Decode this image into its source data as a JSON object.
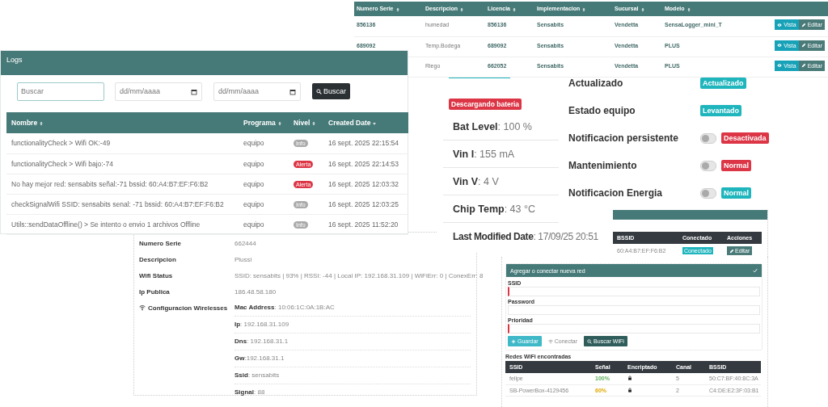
{
  "devices_table": {
    "columns": [
      {
        "label": "Numero Serie",
        "kind": "sortable"
      },
      {
        "label": "Descripcion",
        "kind": "sortable"
      },
      {
        "label": "Licencia",
        "kind": "sortable"
      },
      {
        "label": "Implementacion",
        "kind": "sortable"
      },
      {
        "label": "Sucursal",
        "kind": "sortable"
      },
      {
        "label": "Modelo",
        "kind": "sortable"
      }
    ],
    "rows": [
      {
        "numero_serie": "856136",
        "descripcion": "humedad",
        "licencia": "856136",
        "implementacion": "Sensabits",
        "sucursal": "Vendetta",
        "modelo": "SensaLogger_mini_T",
        "actions": [
          "Vista",
          "Editar"
        ]
      },
      {
        "numero_serie": "689092",
        "descripcion": "Temp.Bodega",
        "licencia": "689092",
        "implementacion": "Sensabits",
        "sucursal": "Vendetta",
        "modelo": "PLUS",
        "actions": [
          "Vista",
          "Editar"
        ]
      },
      {
        "descripcion": "Riego",
        "licencia": "662052",
        "implementacion": "Sensabits",
        "sucursal": "Vendetta",
        "modelo": "PLUS",
        "actions": [
          "Vista",
          "Editar"
        ]
      }
    ]
  },
  "logs": {
    "title": "Logs",
    "search": {
      "placeholder": "Buscar"
    },
    "date_from": {
      "placeholder": "dd/mm/aaaa"
    },
    "date_to": {
      "placeholder": "dd/mm/aaaa"
    },
    "search_button": "Buscar",
    "table": {
      "columns": [
        {
          "label": "Nombre",
          "kind": "sortable"
        },
        {
          "label": "Programa",
          "kind": "sortable"
        },
        {
          "label": "Nivel",
          "kind": "sortable"
        },
        {
          "label": "Created Date",
          "kind": "sorted"
        }
      ],
      "rows": [
        {
          "nombre": "functionalityCheck > Wifi OK:-49",
          "programa": "equipo",
          "nivel": {
            "label": "Info",
            "kind": "info"
          },
          "created": "16 sept. 2025 22:15:54"
        },
        {
          "nombre": "functionalityCheck > Wifi bajo:-74",
          "programa": "equipo",
          "nivel": {
            "label": "Alerta",
            "kind": "alert"
          },
          "created": "16 sept. 2025 22:14:53"
        },
        {
          "nombre": "No hay mejor red: sensabits señal:-71 bssid: 60:A4:B7:EF:F6:B2",
          "programa": "equipo",
          "nivel": {
            "label": "Alerta",
            "kind": "alert"
          },
          "created": "16 sept. 2025 12:03:32"
        },
        {
          "nombre": "checkSignalWifi SSID: sensabits senal: -71 bssid: 60:A4:B7:EF:F6:B2",
          "programa": "equipo",
          "nivel": {
            "label": "Info",
            "kind": "info"
          },
          "created": "16 sept. 2025 12:03:25"
        },
        {
          "nombre": "Utils::sendDataOffline() > Se intento o envio 1 archivos Offline",
          "programa": "equipo",
          "nivel": {
            "label": "Info",
            "kind": "info"
          },
          "created": "16 sept. 2025 11:52:20"
        }
      ]
    }
  },
  "status": {
    "battery_badge": "Descargando bateria",
    "readings": [
      "**Bat Level**: 100 %",
      "**Vin I**: 155 mA",
      "**Vin V**: 4 V",
      "**Chip Temp**: 43 °C",
      "**Last Modified Date**: 17/09/25 20:51"
    ],
    "flags": [
      {
        "label": "Actualizado",
        "kind": "badge",
        "badge": "Actualizado",
        "color": "#1fb5bd"
      },
      {
        "label": "Estado equipo",
        "kind": "badge",
        "badge": "Levantado",
        "color": "#1fb5bd"
      },
      {
        "label": "Notificacion persistente",
        "kind": "switch",
        "on": false,
        "badge": "Desactivada",
        "color": "#dc3545"
      },
      {
        "label": "Mantenimiento",
        "kind": "switch",
        "on": false,
        "badge": "Normal",
        "color": "#dc3545"
      },
      {
        "label": "Notificacion Energia",
        "kind": "switch",
        "on": false,
        "badge": "Normal",
        "color": "#1fb5bd"
      }
    ]
  },
  "device_info": {
    "rows": [
      {
        "label": "Numero Serie",
        "value": "662444"
      },
      {
        "label": "Descripcion",
        "value": "Plussi"
      },
      {
        "label": "Wifi Status",
        "value": "SSID: sensabits | 93% | RSSI: -44 | Local IP: 192.168.31.109 | WiFiErr: 0 | ConexErr: 8"
      },
      {
        "label": "Ip Publica",
        "value": "186.48.58.180"
      }
    ],
    "wireless": {
      "label": "Configuracion Wirelesses",
      "items": [
        "**Mac Address**: 10:06:1C:0A:1B:AC",
        "**Ip**: 192.168.31.109",
        "**Dns**: 192.168.31.1",
        "**Gw**:192.168.31.1",
        "**Ssid**: sensabits",
        "**Signal**: 88"
      ]
    }
  },
  "saved_networks": {
    "columns": [
      "BSSID",
      "Conectado",
      "Acciones"
    ],
    "rows": [
      {
        "bssid": "60:A4:B7:EF:F6:B2",
        "conectado": "Conectado",
        "action": "Editar"
      }
    ]
  },
  "new_network_form": {
    "title": "Agregar o conectar nueva red",
    "fields": [
      {
        "label": "SSID",
        "invalid": true
      },
      {
        "label": "Password",
        "invalid": false
      },
      {
        "label": "Prioridad",
        "invalid": true
      }
    ],
    "buttons": [
      {
        "label": "Guardar",
        "kind": "save"
      },
      {
        "label": "Conectar",
        "kind": "connect"
      },
      {
        "label": "Buscar WiFi",
        "kind": "scan"
      }
    ]
  },
  "found_networks": {
    "title": "Redes WiFi encontradas",
    "columns": [
      "SSID",
      "Señal",
      "Encriptado",
      "Canal",
      "BSSID"
    ],
    "rows": [
      {
        "ssid": "felipe",
        "senal": "100%",
        "kind": "strong",
        "encrypted": true,
        "canal": "5",
        "bssid": "50:C7:BF:40:8C:3A"
      },
      {
        "ssid": "SB-PowerBox-4129456",
        "senal": "60%",
        "kind": "medium",
        "encrypted": true,
        "canal": "2",
        "bssid": "C4:DE:E2:3F:03:B1"
      }
    ]
  }
}
